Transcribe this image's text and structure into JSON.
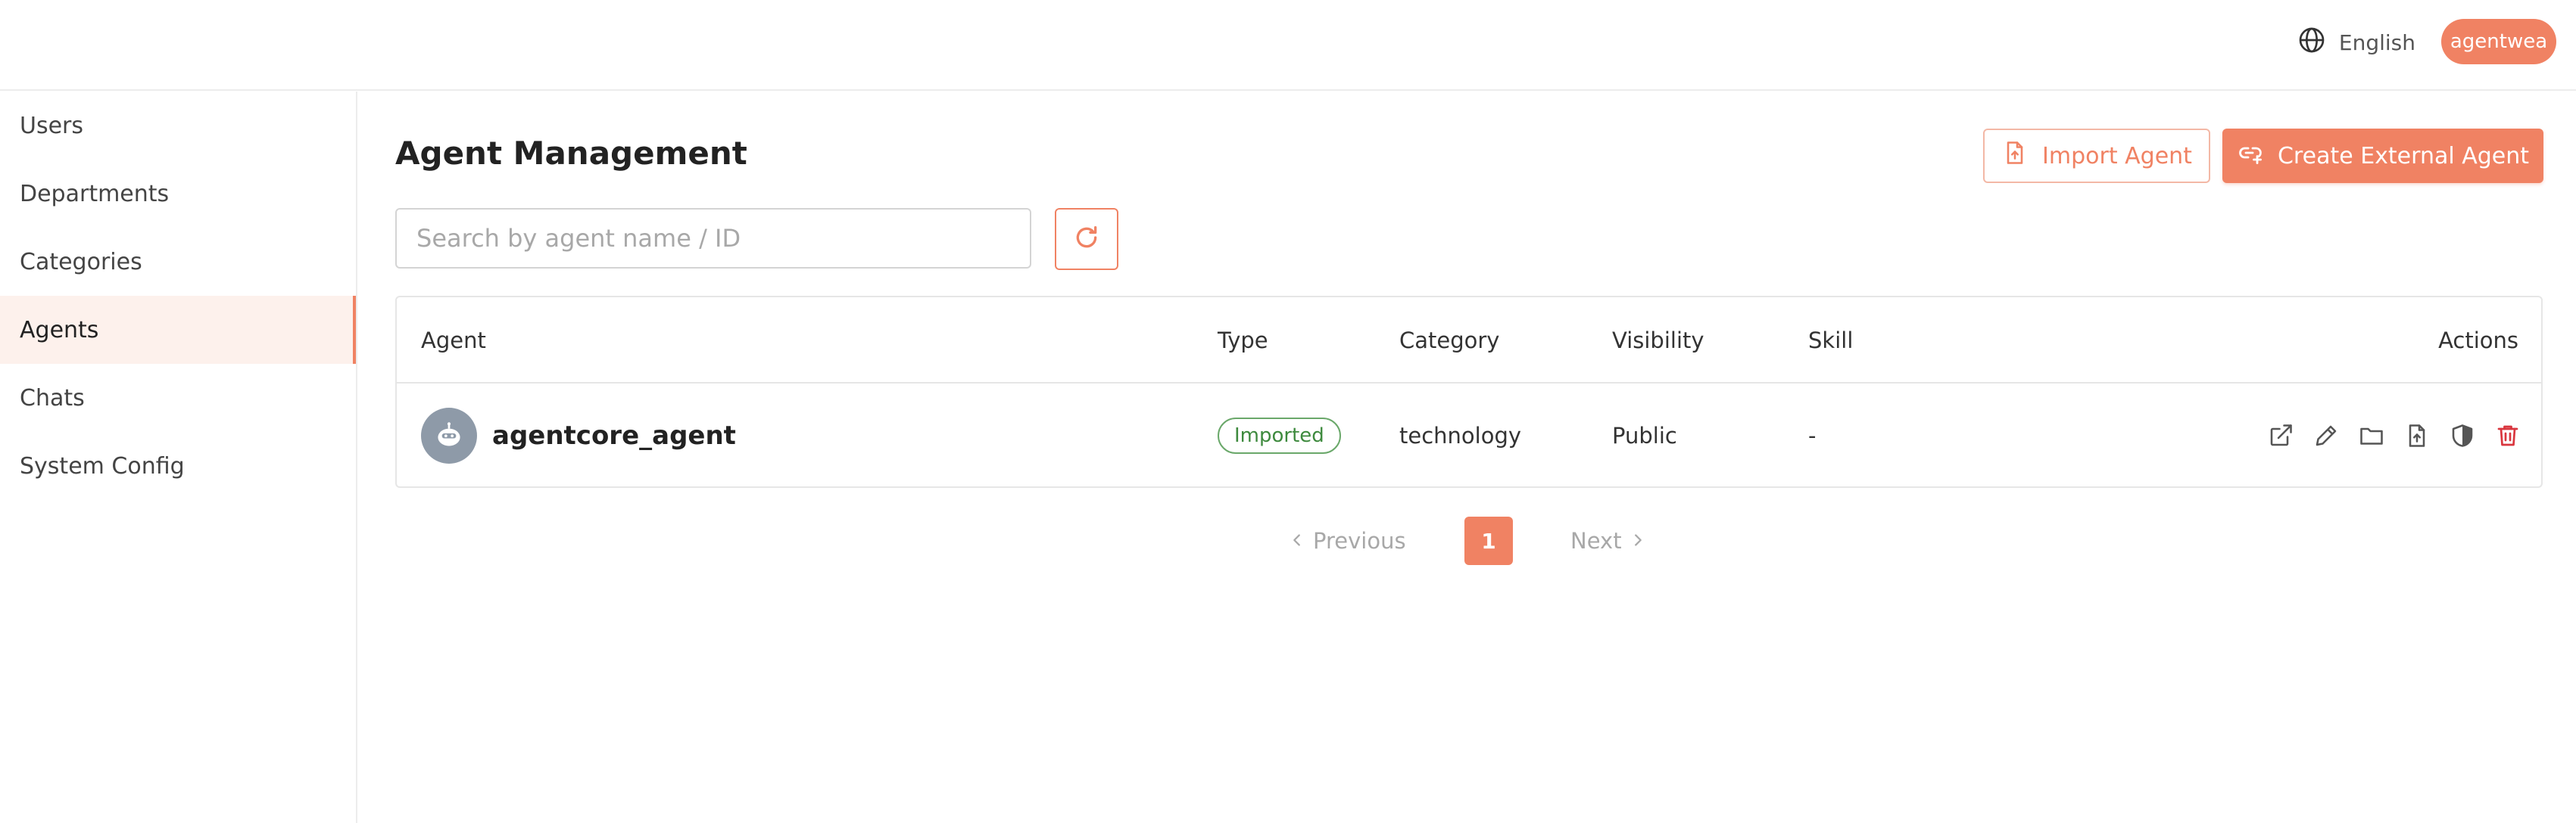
{
  "topbar": {
    "language": "English",
    "icon": "globe-icon",
    "user": "agentwea"
  },
  "sidebar": {
    "items": [
      {
        "label": "Users"
      },
      {
        "label": "Departments"
      },
      {
        "label": "Categories"
      },
      {
        "label": "Agents",
        "active": true
      },
      {
        "label": "Chats"
      },
      {
        "label": "System Config"
      }
    ]
  },
  "main": {
    "title": "Agent Management",
    "import_label": "Import Agent",
    "create_label": "Create External Agent",
    "search": {
      "placeholder": "Search by agent name / ID",
      "value": ""
    },
    "table": {
      "headers": {
        "agent": "Agent",
        "type": "Type",
        "category": "Category",
        "visibility": "Visibility",
        "skill": "Skill",
        "actions": "Actions"
      },
      "rows": [
        {
          "name": "agentcore_agent",
          "type": "Imported",
          "category": "technology",
          "visibility": "Public",
          "skill": "-",
          "actions": [
            "open-external-icon",
            "edit-icon",
            "folder-icon",
            "export-icon",
            "shield-icon",
            "delete-icon"
          ]
        }
      ]
    },
    "pagination": {
      "previous": "Previous",
      "page": "1",
      "next": "Next"
    }
  },
  "colors": {
    "accent": "#f08263",
    "accent_light": "#fdf1ec",
    "badge_green": "#3e8a3e",
    "danger": "#d9363e"
  }
}
